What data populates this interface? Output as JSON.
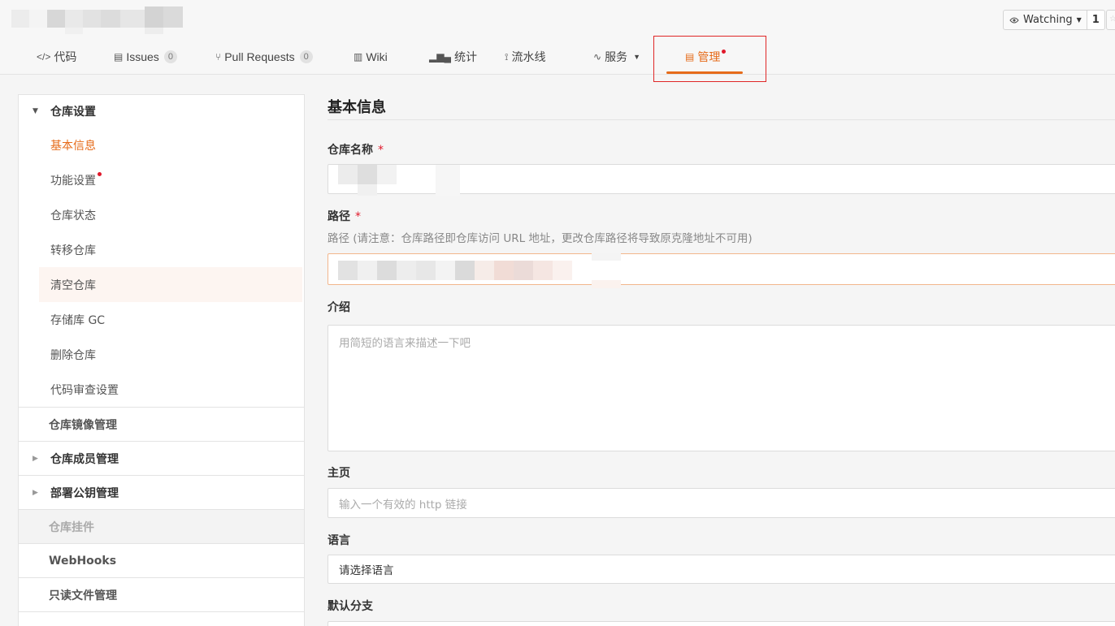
{
  "header": {
    "watch": {
      "label": "Watching",
      "count": "1"
    }
  },
  "tabs": [
    {
      "label": "代码",
      "icon": "code-icon"
    },
    {
      "label": "Issues",
      "icon": "issues-icon",
      "count": "0"
    },
    {
      "label": "Pull Requests",
      "icon": "pull-request-icon",
      "count": "0"
    },
    {
      "label": "Wiki",
      "icon": "book-icon"
    },
    {
      "label": "统计",
      "icon": "bar-chart-icon"
    },
    {
      "label": "流水线",
      "icon": "pipeline-icon"
    },
    {
      "label": "服务",
      "icon": "pulse-icon"
    },
    {
      "label": "管理",
      "icon": "manage-icon",
      "active": true
    }
  ],
  "sidebar": {
    "group_title": "仓库设置",
    "items": [
      {
        "label": "基本信息",
        "active": true
      },
      {
        "label": "功能设置",
        "dot": true
      },
      {
        "label": "仓库状态"
      },
      {
        "label": "转移仓库"
      },
      {
        "label": "清空仓库",
        "hover": true
      },
      {
        "label": "存储库 GC"
      },
      {
        "label": "删除仓库"
      },
      {
        "label": "代码审查设置"
      }
    ],
    "sections": [
      {
        "label": "仓库镜像管理"
      },
      {
        "label": "仓库成员管理",
        "expandable": true
      },
      {
        "label": "部署公钥管理",
        "expandable": true
      },
      {
        "label": "仓库挂件",
        "disabled": true
      },
      {
        "label": "WebHooks"
      },
      {
        "label": "只读文件管理"
      }
    ]
  },
  "form": {
    "title": "基本信息",
    "name_label": "仓库名称",
    "required_mark": "*",
    "path_label": "路径",
    "path_hint": "路径 (请注意：仓库路径即仓库访问 URL 地址，更改仓库路径将导致原克隆地址不可用)",
    "desc_label": "介绍",
    "desc_placeholder": "用简短的语言来描述一下吧",
    "homepage_label": "主页",
    "homepage_placeholder": "输入一个有效的 http 链接",
    "language_label": "语言",
    "language_value": "请选择语言",
    "branch_label": "默认分支"
  },
  "colors": {
    "accent": "#e66b1a",
    "required": "#e0192b",
    "highlight_box": "#e02727"
  }
}
